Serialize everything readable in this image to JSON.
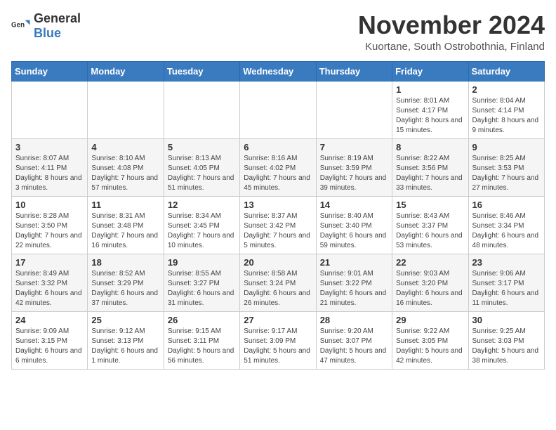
{
  "logo": {
    "text_general": "General",
    "text_blue": "Blue"
  },
  "calendar": {
    "title": "November 2024",
    "subtitle": "Kuortane, South Ostrobothnia, Finland",
    "headers": [
      "Sunday",
      "Monday",
      "Tuesday",
      "Wednesday",
      "Thursday",
      "Friday",
      "Saturday"
    ],
    "weeks": [
      [
        {
          "day": "",
          "info": ""
        },
        {
          "day": "",
          "info": ""
        },
        {
          "day": "",
          "info": ""
        },
        {
          "day": "",
          "info": ""
        },
        {
          "day": "",
          "info": ""
        },
        {
          "day": "1",
          "info": "Sunrise: 8:01 AM\nSunset: 4:17 PM\nDaylight: 8 hours and 15 minutes."
        },
        {
          "day": "2",
          "info": "Sunrise: 8:04 AM\nSunset: 4:14 PM\nDaylight: 8 hours and 9 minutes."
        }
      ],
      [
        {
          "day": "3",
          "info": "Sunrise: 8:07 AM\nSunset: 4:11 PM\nDaylight: 8 hours and 3 minutes."
        },
        {
          "day": "4",
          "info": "Sunrise: 8:10 AM\nSunset: 4:08 PM\nDaylight: 7 hours and 57 minutes."
        },
        {
          "day": "5",
          "info": "Sunrise: 8:13 AM\nSunset: 4:05 PM\nDaylight: 7 hours and 51 minutes."
        },
        {
          "day": "6",
          "info": "Sunrise: 8:16 AM\nSunset: 4:02 PM\nDaylight: 7 hours and 45 minutes."
        },
        {
          "day": "7",
          "info": "Sunrise: 8:19 AM\nSunset: 3:59 PM\nDaylight: 7 hours and 39 minutes."
        },
        {
          "day": "8",
          "info": "Sunrise: 8:22 AM\nSunset: 3:56 PM\nDaylight: 7 hours and 33 minutes."
        },
        {
          "day": "9",
          "info": "Sunrise: 8:25 AM\nSunset: 3:53 PM\nDaylight: 7 hours and 27 minutes."
        }
      ],
      [
        {
          "day": "10",
          "info": "Sunrise: 8:28 AM\nSunset: 3:50 PM\nDaylight: 7 hours and 22 minutes."
        },
        {
          "day": "11",
          "info": "Sunrise: 8:31 AM\nSunset: 3:48 PM\nDaylight: 7 hours and 16 minutes."
        },
        {
          "day": "12",
          "info": "Sunrise: 8:34 AM\nSunset: 3:45 PM\nDaylight: 7 hours and 10 minutes."
        },
        {
          "day": "13",
          "info": "Sunrise: 8:37 AM\nSunset: 3:42 PM\nDaylight: 7 hours and 5 minutes."
        },
        {
          "day": "14",
          "info": "Sunrise: 8:40 AM\nSunset: 3:40 PM\nDaylight: 6 hours and 59 minutes."
        },
        {
          "day": "15",
          "info": "Sunrise: 8:43 AM\nSunset: 3:37 PM\nDaylight: 6 hours and 53 minutes."
        },
        {
          "day": "16",
          "info": "Sunrise: 8:46 AM\nSunset: 3:34 PM\nDaylight: 6 hours and 48 minutes."
        }
      ],
      [
        {
          "day": "17",
          "info": "Sunrise: 8:49 AM\nSunset: 3:32 PM\nDaylight: 6 hours and 42 minutes."
        },
        {
          "day": "18",
          "info": "Sunrise: 8:52 AM\nSunset: 3:29 PM\nDaylight: 6 hours and 37 minutes."
        },
        {
          "day": "19",
          "info": "Sunrise: 8:55 AM\nSunset: 3:27 PM\nDaylight: 6 hours and 31 minutes."
        },
        {
          "day": "20",
          "info": "Sunrise: 8:58 AM\nSunset: 3:24 PM\nDaylight: 6 hours and 26 minutes."
        },
        {
          "day": "21",
          "info": "Sunrise: 9:01 AM\nSunset: 3:22 PM\nDaylight: 6 hours and 21 minutes."
        },
        {
          "day": "22",
          "info": "Sunrise: 9:03 AM\nSunset: 3:20 PM\nDaylight: 6 hours and 16 minutes."
        },
        {
          "day": "23",
          "info": "Sunrise: 9:06 AM\nSunset: 3:17 PM\nDaylight: 6 hours and 11 minutes."
        }
      ],
      [
        {
          "day": "24",
          "info": "Sunrise: 9:09 AM\nSunset: 3:15 PM\nDaylight: 6 hours and 6 minutes."
        },
        {
          "day": "25",
          "info": "Sunrise: 9:12 AM\nSunset: 3:13 PM\nDaylight: 6 hours and 1 minute."
        },
        {
          "day": "26",
          "info": "Sunrise: 9:15 AM\nSunset: 3:11 PM\nDaylight: 5 hours and 56 minutes."
        },
        {
          "day": "27",
          "info": "Sunrise: 9:17 AM\nSunset: 3:09 PM\nDaylight: 5 hours and 51 minutes."
        },
        {
          "day": "28",
          "info": "Sunrise: 9:20 AM\nSunset: 3:07 PM\nDaylight: 5 hours and 47 minutes."
        },
        {
          "day": "29",
          "info": "Sunrise: 9:22 AM\nSunset: 3:05 PM\nDaylight: 5 hours and 42 minutes."
        },
        {
          "day": "30",
          "info": "Sunrise: 9:25 AM\nSunset: 3:03 PM\nDaylight: 5 hours and 38 minutes."
        }
      ]
    ]
  }
}
